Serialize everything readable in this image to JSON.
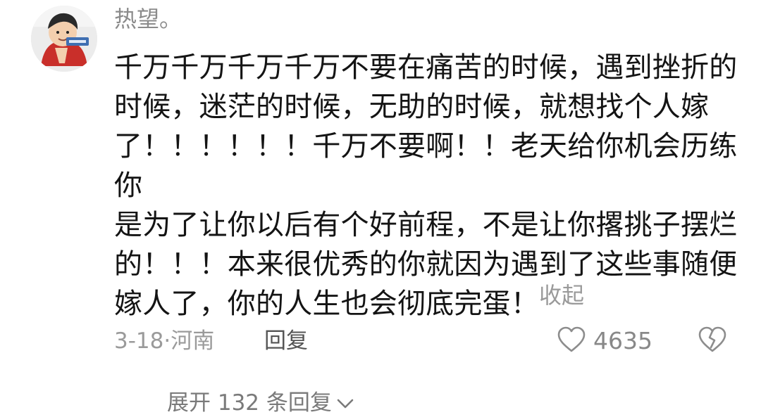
{
  "comment": {
    "username": "热望。",
    "avatar_icon": "user-avatar",
    "body_lines": [
      "千万千万千万千万不要在痛苦的时候，遇到挫折的",
      "时候，迷茫的时候，无助的时候，就想找个人嫁",
      "了！！！！！！千万不要啊！！老天给你机会历练你",
      "是为了让你以后有个好前程，不是让你撂挑子摆烂",
      "的！！！本来很优秀的你就因为遇到了这些事随便",
      "嫁人了，你的人生也会彻底完蛋！"
    ],
    "collapse_label": "收起",
    "date": "3-18",
    "location": "河南",
    "reply_label": "回复",
    "like_count": "4635",
    "like_icon": "heart-outline-icon",
    "dislike_icon": "broken-heart-icon",
    "expand_replies_label": "展开 132 条回复",
    "expand_icon": "chevron-down-icon"
  }
}
